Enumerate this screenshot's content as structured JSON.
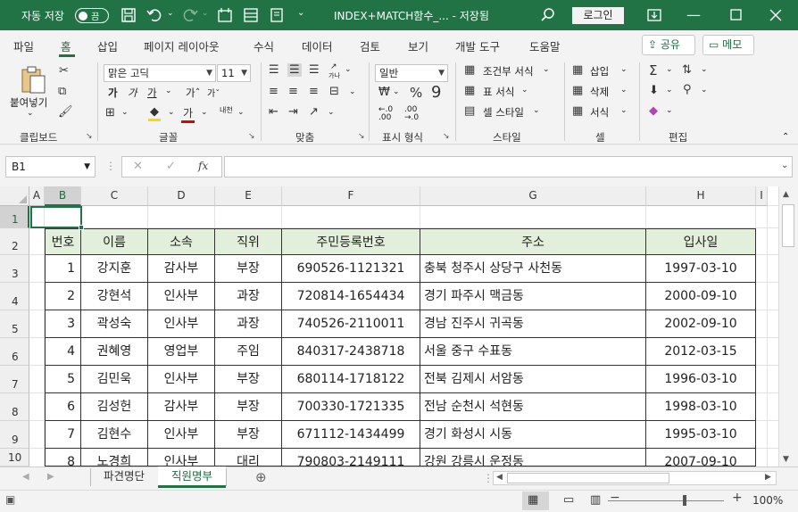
{
  "titlebar": {
    "autosave_label": "자동 저장",
    "toggle_state": "끔",
    "document_title": "INDEX+MATCH함수_...  -  저장됨",
    "login_label": "로그인"
  },
  "ribbon_tabs": [
    "파일",
    "홈",
    "삽입",
    "페이지 레이아웃",
    "수식",
    "데이터",
    "검토",
    "보기",
    "개발 도구",
    "도움말"
  ],
  "active_tab": "홈",
  "share_label": "공유",
  "memo_label": "메모",
  "ribbon": {
    "clipboard": {
      "paste_label": "붙여넣기",
      "group_label": "클립보드"
    },
    "font": {
      "font_name": "맑은 고딕",
      "font_size": "11",
      "group_label": "글꼴",
      "bold": "가",
      "italic": "가",
      "underline": "가",
      "grow": "가ˆ",
      "shrink": "가ˇ",
      "phonetic": "내천"
    },
    "alignment": {
      "group_label": "맞춤",
      "wrap": "가나"
    },
    "number": {
      "format": "일반",
      "group_label": "표시 형식"
    },
    "styles": {
      "conditional": "조건부 서식",
      "table": "표 서식",
      "cell_styles": "셀 스타일",
      "group_label": "스타일"
    },
    "cells": {
      "insert": "삽입",
      "delete": "삭제",
      "format": "서식",
      "group_label": "셀"
    },
    "editing": {
      "group_label": "편집"
    }
  },
  "formula_bar": {
    "name_box": "B1",
    "fx": "fx",
    "formula": ""
  },
  "columns": [
    "A",
    "B",
    "C",
    "D",
    "E",
    "F",
    "G",
    "H",
    "I"
  ],
  "rows": [
    "1",
    "2",
    "3",
    "4",
    "5",
    "6",
    "7",
    "8",
    "9",
    "10"
  ],
  "selected_cell": "B1",
  "table": {
    "headers": [
      "번호",
      "이름",
      "소속",
      "직위",
      "주민등록번호",
      "주소",
      "입사일"
    ],
    "rows": [
      [
        "1",
        "강지훈",
        "감사부",
        "부장",
        "690526-1121321",
        "충북 청주시 상당구 사천동",
        "1997-03-10"
      ],
      [
        "2",
        "강현석",
        "인사부",
        "과장",
        "720814-1654434",
        "경기 파주시 맥금동",
        "2000-09-10"
      ],
      [
        "3",
        "곽성숙",
        "인사부",
        "과장",
        "740526-2110011",
        "경남 진주시 귀곡동",
        "2002-09-10"
      ],
      [
        "4",
        "권혜영",
        "영업부",
        "주임",
        "840317-2438718",
        "서울 중구 수표동",
        "2012-03-15"
      ],
      [
        "5",
        "김민욱",
        "인사부",
        "부장",
        "680114-1718122",
        "전북 김제시 서암동",
        "1996-03-10"
      ],
      [
        "6",
        "김성헌",
        "감사부",
        "부장",
        "700330-1721335",
        "전남 순천시 석현동",
        "1998-03-10"
      ],
      [
        "7",
        "김현수",
        "인사부",
        "부장",
        "671112-1434499",
        "경기 화성시 시동",
        "1995-03-10"
      ],
      [
        "8",
        "노경희",
        "인사부",
        "대리",
        "790803-2149111",
        "강원 강릉시 운정동",
        "2007-09-10"
      ]
    ]
  },
  "sheets": [
    "파견명단",
    "직원명부"
  ],
  "active_sheet": "직원명부",
  "status": {
    "zoom": "100%"
  },
  "colors": {
    "brand": "#217346",
    "header_fill": "#e2efda"
  }
}
